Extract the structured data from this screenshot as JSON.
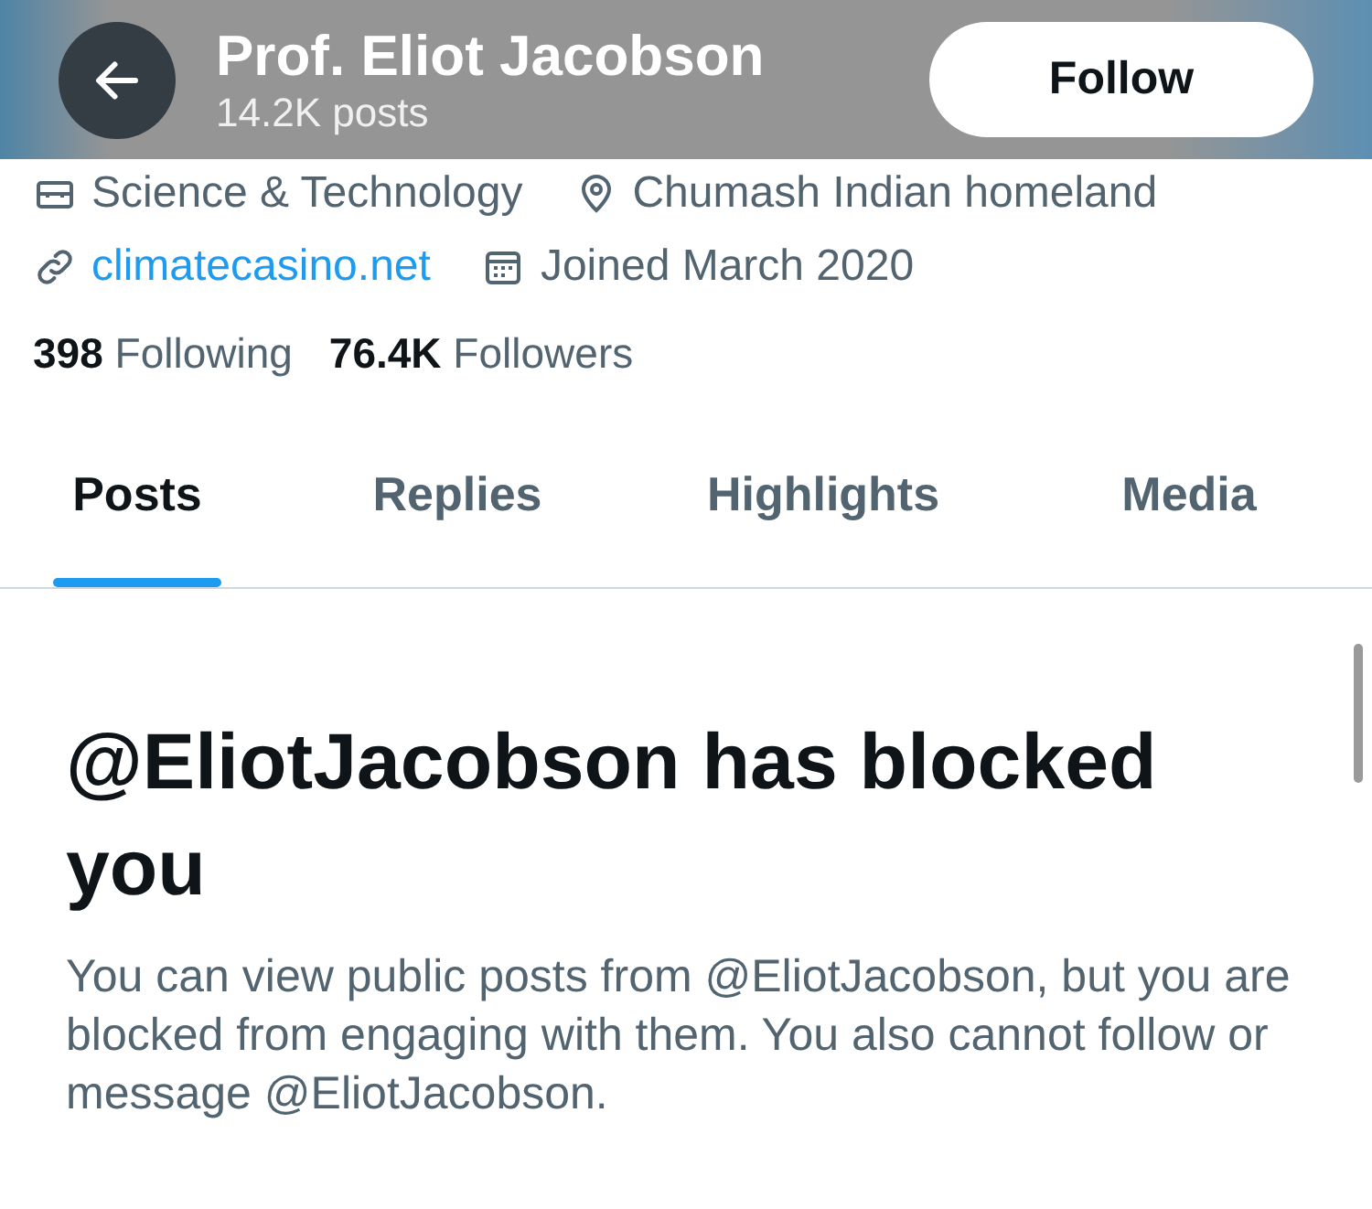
{
  "header": {
    "name": "Prof. Eliot Jacobson",
    "posts": "14.2K posts",
    "follow_button": "Follow"
  },
  "profile": {
    "category": "Science & Technology",
    "location": "Chumash Indian homeland",
    "website": "climatecasino.net",
    "joined": "Joined March 2020"
  },
  "stats": [
    {
      "count": "398",
      "label": "Following"
    },
    {
      "count": "76.4K",
      "label": "Followers"
    }
  ],
  "tabs": [
    {
      "label": "Posts",
      "selected": true
    },
    {
      "label": "Replies",
      "selected": false
    },
    {
      "label": "Highlights",
      "selected": false
    },
    {
      "label": "Media",
      "selected": false
    }
  ],
  "notice": {
    "title": "@EliotJacobson has blocked you",
    "body": "You can view public posts from @EliotJacobson, but you are blocked from engaging with them. You also cannot follow or message @EliotJacobson."
  }
}
